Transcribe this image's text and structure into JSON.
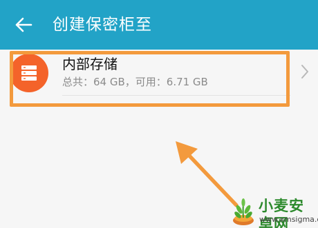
{
  "appbar": {
    "title": "创建保密柜至",
    "back_icon": "arrow-left-icon",
    "background": "#22a3c7"
  },
  "storage": {
    "name": "内部存储",
    "detail": "总共：64 GB，可用：6.71 GB",
    "icon": "storage-icon",
    "icon_color": "#f4632a"
  },
  "annotation": {
    "color": "#f39a3d"
  },
  "watermark": {
    "name": "小麦安卓网",
    "url": "www.xmsigma.com"
  }
}
